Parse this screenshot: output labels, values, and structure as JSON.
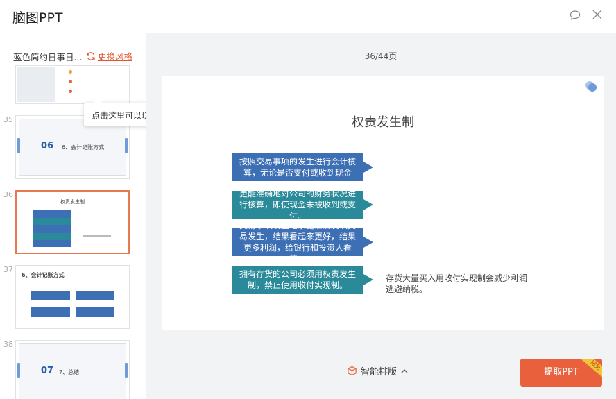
{
  "header": {
    "title": "脑图PPT",
    "comment_icon": "comment-icon",
    "close_icon": "close-icon"
  },
  "sidebar": {
    "deck_name": "蓝色简约日事日...",
    "change_style_label": "更换风格",
    "tooltip": "点击这里可以切换不同风格",
    "thumbnails": [
      {
        "num": "35",
        "title": "06",
        "subtitle": "6、会计记账方式"
      },
      {
        "num": "36",
        "title": "权责发生制",
        "subtitle": ""
      },
      {
        "num": "37",
        "title": "6、会计记账方式",
        "subtitle": ""
      },
      {
        "num": "38",
        "title": "07",
        "subtitle": "7、总结"
      }
    ]
  },
  "main": {
    "page_indicator": "36/44页",
    "slide": {
      "title": "权责发生制",
      "rows": [
        "按照交易事项的发生进行会计核算，无论是否支付或收到现金",
        "更能准确地对公司的财务状况进行核算，即使现金未被收到或支付。",
        "交易事项发生记录更准确反映交易发生，结果看起来更好，结果更多利润，给银行和投资人看的。",
        "拥有存货的公司必须用权责发生制，禁止使用收付实现制。"
      ],
      "side_note": "存货大量买入用收付实现制会减少利润逃避纳税。"
    },
    "smart_layout_label": "智能排版",
    "cta_label": "提取PPT",
    "cta_badge": "限免",
    "colors": {
      "accent": "#e8603c",
      "row_blue": "#3d6fb4",
      "row_teal": "#2a8a9a"
    }
  }
}
